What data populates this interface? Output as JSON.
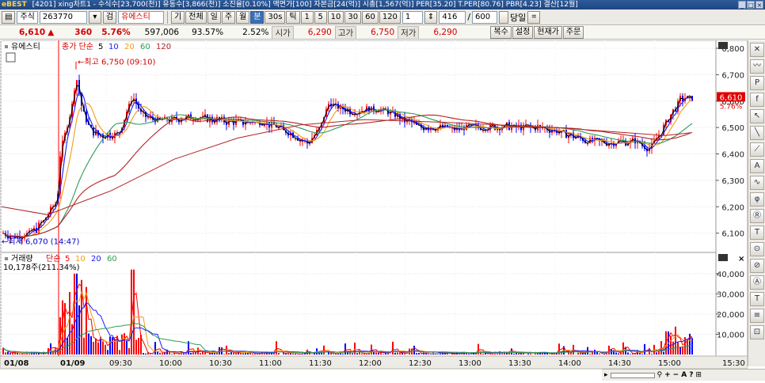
{
  "window": {
    "title": "[4201] xing차트1 - 수식수[23,700(천)] 유동수[3,866(천)] 소진율[0.10%] 액면가[100] 자본금[24(억)] 시총[1,567(억)] PER[35.20] T.PER[80.76] PBR[4.23] 결산[12월]",
    "logo": "eBEST"
  },
  "toolbar": {
    "type_label": "주식",
    "code_value": "263770",
    "name_value": "유에스티",
    "buttons": [
      "기",
      "전체",
      "일",
      "주",
      "월",
      "분",
      "30s",
      "틱",
      "1",
      "5",
      "10",
      "30",
      "60",
      "120"
    ],
    "selected": "분",
    "interval_value": "1",
    "count_value": "416",
    "count_total": "600",
    "today_label": "당일"
  },
  "info": {
    "price": "6,610",
    "arrow": "▲",
    "change": "360",
    "change_pct": "5.76%",
    "volume": "597,006",
    "vol_ratio": "93.57%",
    "turnover": "2.52%",
    "open_label": "시가",
    "open": "6,290",
    "high_label": "고가",
    "high": "6,750",
    "low_label": "저가",
    "low": "6,290",
    "buttons": [
      "복수",
      "설정",
      "현재가",
      "주문"
    ]
  },
  "price_panel": {
    "name": "유에스티",
    "ma_title": "종가 단순",
    "ma_periods": [
      "5",
      "10",
      "20",
      "60",
      "120"
    ],
    "ma_colors": [
      "#000000",
      "#1a1aff",
      "#f39c12",
      "#2e9b57",
      "#b22222"
    ],
    "high_note": "최고 6,750 (09:10)",
    "low_note": "최저 6,070 (14:47)",
    "y_ticks": [
      "6,800",
      "6,700",
      "6,600",
      "6,500",
      "6,400",
      "6,300",
      "6,200",
      "6,100"
    ],
    "last_price": "6,610",
    "last_pct": "5.76%"
  },
  "volume_panel": {
    "title": "거래량",
    "ma_title": "단순",
    "ma_periods": [
      "5",
      "10",
      "20",
      "60"
    ],
    "ma_colors": [
      "#ff0000",
      "#f39c12",
      "#1a1aff",
      "#2e9b57"
    ],
    "last_value": "10,178주(211.34%)",
    "y_ticks": [
      "40,000",
      "30,000",
      "20,000",
      "10,000"
    ]
  },
  "x_axis": [
    "01/08",
    "01/09",
    "09:30",
    "10:00",
    "10:30",
    "11:00",
    "11:30",
    "12:00",
    "12:30",
    "13:00",
    "13:30",
    "14:00",
    "14:30",
    "15:00",
    "15:30"
  ],
  "colors": {
    "up": "#ff0000",
    "down": "#0000ff",
    "accent": "#3a6fb6"
  },
  "side_tools": [
    "✕",
    "〰",
    "P",
    "f",
    "↖",
    "╲",
    "⟋",
    "A",
    "∿",
    "φ",
    "Ⓡ",
    "T",
    "⊙",
    "⊘",
    "Ⓐ",
    "T",
    "≡",
    "⊡"
  ]
}
